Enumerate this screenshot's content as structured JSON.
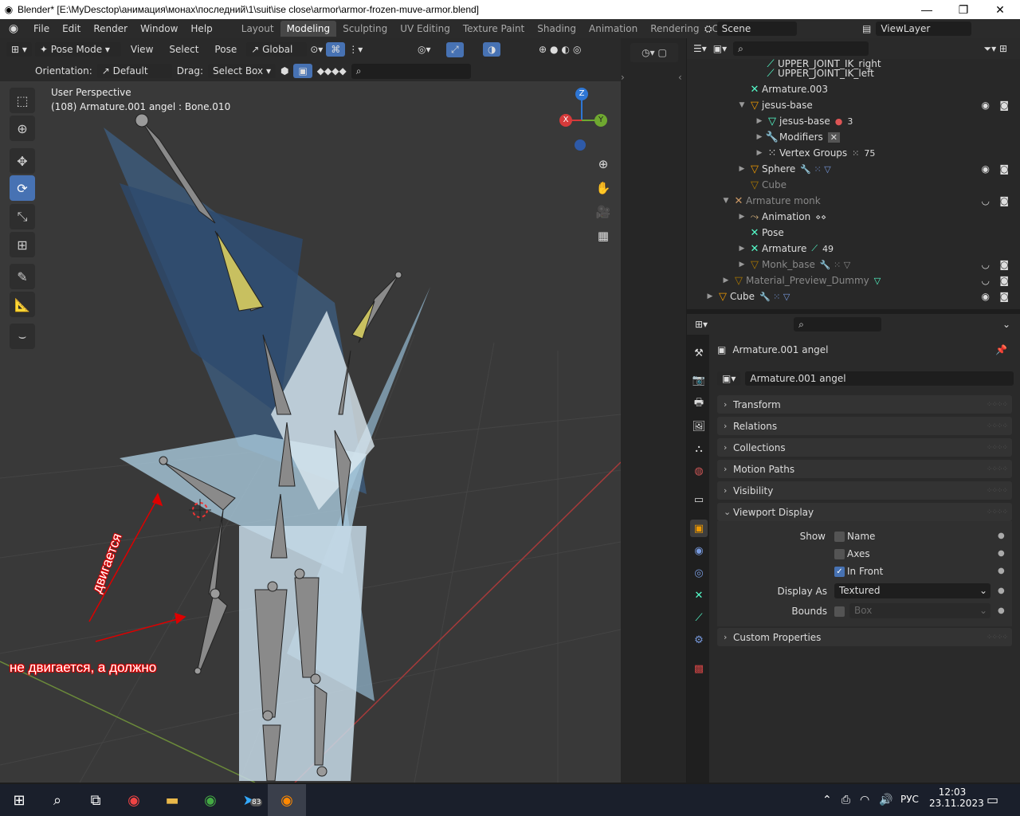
{
  "titlebar": {
    "title": "Blender* [E:\\MyDesctop\\анимация\\монах\\последний\\1\\suit\\ise close\\armor\\armor-frozen-muve-armor.blend]",
    "minimize": "—",
    "maximize": "❐",
    "close": "✕"
  },
  "menus": [
    "File",
    "Edit",
    "Render",
    "Window",
    "Help"
  ],
  "workspaces": [
    "Layout",
    "Modeling",
    "Sculpting",
    "UV Editing",
    "Texture Paint",
    "Shading",
    "Animation",
    "Rendering",
    "Compositing"
  ],
  "scene": {
    "name": "Scene",
    "view_layer": "ViewLayer"
  },
  "viewport_header": {
    "mode": "Pose Mode",
    "menus": [
      "View",
      "Select",
      "Pose"
    ],
    "orientation_space": "Global"
  },
  "tool_settings": {
    "orientation_label": "Orientation:",
    "orientation_value": "Default",
    "drag_label": "Drag:",
    "drag_value": "Select Box"
  },
  "viewport": {
    "perspective": "User Perspective",
    "active_info": "(108) Armature.001 angel : Bone.010",
    "gizmo": {
      "z": "Z",
      "x": "X",
      "y": "Y"
    }
  },
  "annotations": {
    "moves": "двигается",
    "not_moving": "не двигается, а должно"
  },
  "outliner": {
    "rows": [
      {
        "label": "UPPER_JOINT_IK_right",
        "icon": "bone-icon"
      },
      {
        "label": "UPPER_JOINT_IK_left",
        "icon": "bone-icon"
      },
      {
        "label": "Armature.003",
        "icon": "armature-icon"
      },
      {
        "label": "jesus-base",
        "icon": "mesh-object-icon",
        "extra": "3"
      },
      {
        "label": "jesus-base",
        "icon": "mesh-data-icon",
        "extra": "3"
      },
      {
        "label": "Modifiers",
        "icon": "wrench-icon"
      },
      {
        "label": "Vertex Groups",
        "icon": "vertex-groups-icon",
        "extra": "75"
      },
      {
        "label": "Sphere",
        "icon": "mesh-object-icon"
      },
      {
        "label": "Cube",
        "icon": "mesh-object-icon"
      },
      {
        "label": "Armature monk",
        "icon": "armature-icon"
      },
      {
        "label": "Animation",
        "icon": "animation-icon"
      },
      {
        "label": "Pose",
        "icon": "pose-icon"
      },
      {
        "label": "Armature",
        "icon": "armature-icon",
        "extra": "49"
      },
      {
        "label": "Monk_base",
        "icon": "mesh-object-icon"
      },
      {
        "label": "Material_Preview_Dummy",
        "icon": "mesh-object-icon"
      },
      {
        "label": "Cube",
        "icon": "mesh-object-icon"
      }
    ]
  },
  "properties": {
    "object_name": "Armature.001 angel",
    "name_field": "Armature.001 angel",
    "panels": [
      "Transform",
      "Relations",
      "Collections",
      "Motion Paths",
      "Visibility",
      "Viewport Display",
      "Custom Properties"
    ],
    "viewport_display": {
      "show_label": "Show",
      "name_label": "Name",
      "axes_label": "Axes",
      "in_front_label": "In Front",
      "display_as_label": "Display As",
      "display_as_value": "Textured",
      "bounds_label": "Bounds",
      "bounds_value": "Box",
      "name_checked": false,
      "axes_checked": false,
      "in_front_checked": true,
      "bounds_checked": false
    }
  },
  "taskbar": {
    "language": "РУС",
    "time": "12:03",
    "date": "23.11.2023",
    "telegram_badge": "83"
  },
  "colors": {
    "accent": "#4772b3",
    "annotation": "#dd0000",
    "bone_selected": "#c8c060"
  }
}
